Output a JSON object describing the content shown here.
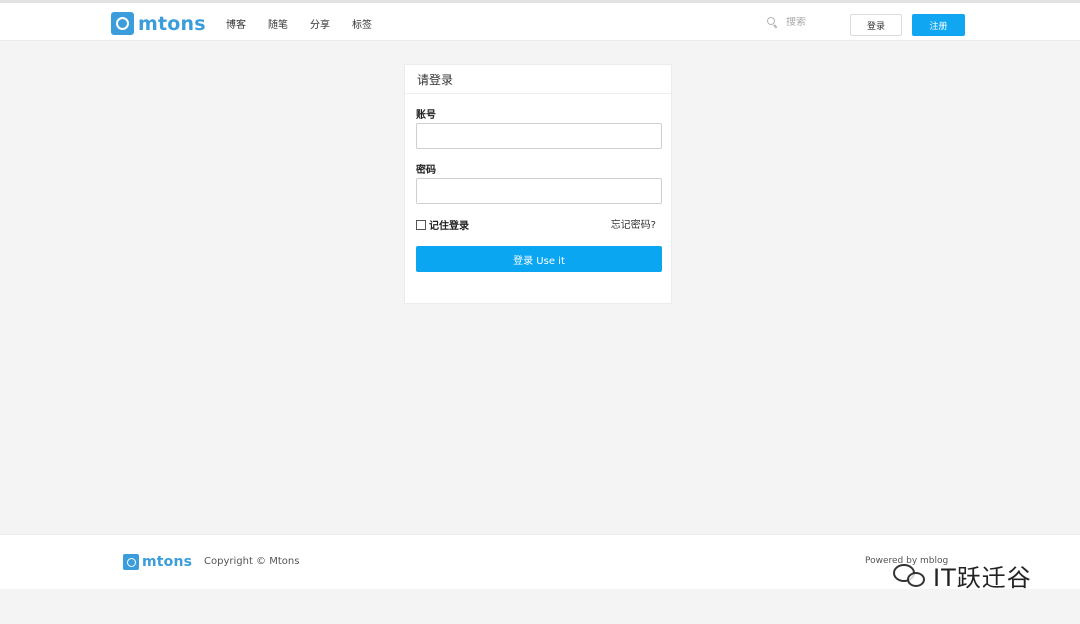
{
  "header": {
    "logo_text": "mtons",
    "nav": [
      "博客",
      "随笔",
      "分享",
      "标签"
    ],
    "search_placeholder": "搜索",
    "login_label": "登录",
    "register_label": "注册"
  },
  "login_panel": {
    "title": "请登录",
    "account_label": "账号",
    "account_value": "",
    "password_label": "密码",
    "password_value": "",
    "remember_label": "记住登录",
    "remember_checked": false,
    "forgot_label": "忘记密码?",
    "submit_label": "登录 Use it"
  },
  "footer": {
    "logo_text": "mtons",
    "copyright": "Copyright © Mtons",
    "powered": "Powered by mblog"
  },
  "watermark": {
    "text": "IT跃迁谷"
  },
  "colors": {
    "brand": "#3b9ddb",
    "accent": "#11a6f2",
    "background": "#f4f4f4"
  }
}
